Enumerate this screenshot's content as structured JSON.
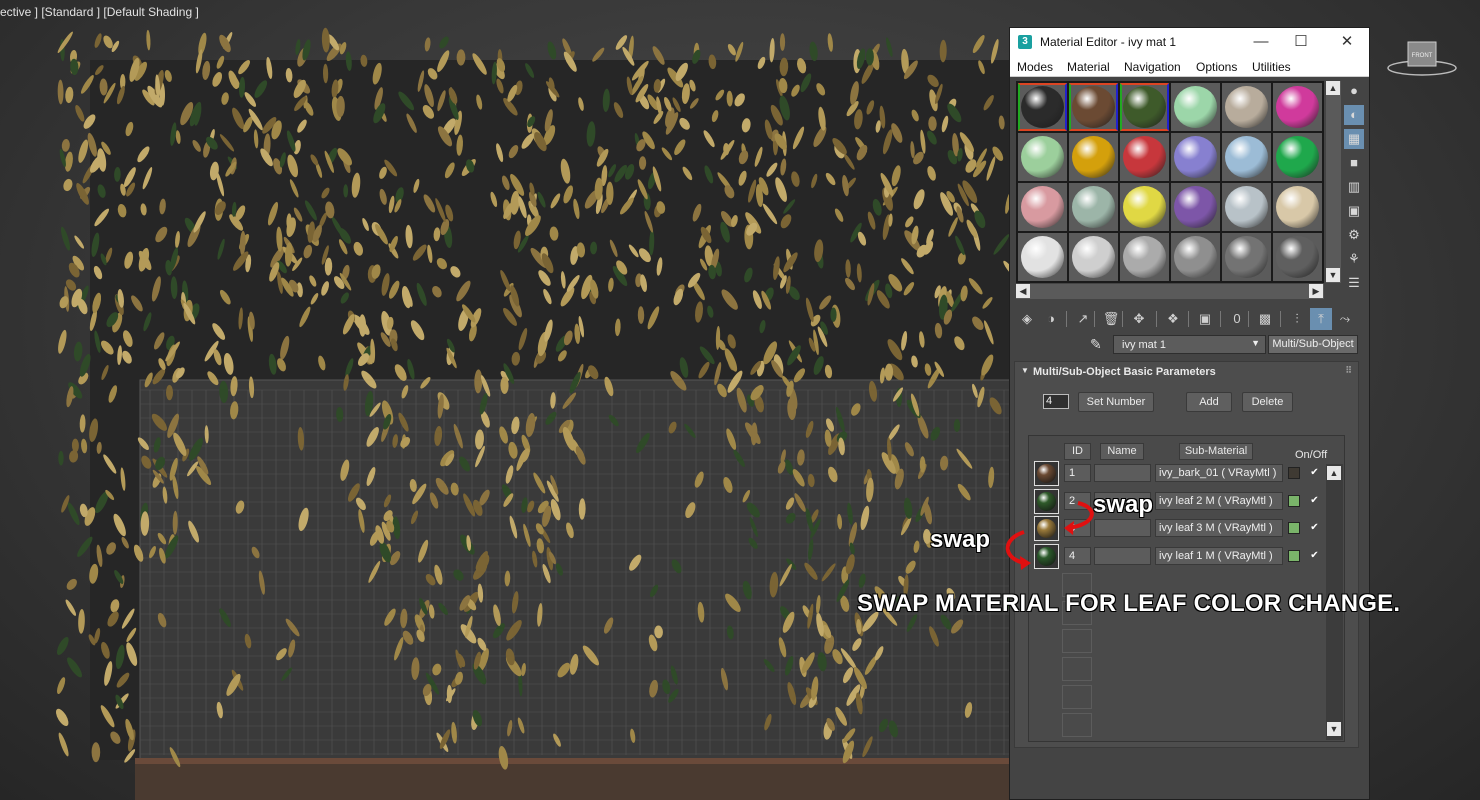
{
  "viewport": {
    "label": "ective ] [Standard ] [Default Shading ]",
    "viewcube_label": "FRONT"
  },
  "window": {
    "icon": "3",
    "title": "Material Editor -  ivy mat 1",
    "controls": {
      "minimize": "—",
      "maximize": "☐",
      "close": "✕"
    }
  },
  "menu": [
    "Modes",
    "Material",
    "Navigation",
    "Options",
    "Utilities"
  ],
  "slots": [
    {
      "color": "#2b2b2b",
      "used": true,
      "selected": true
    },
    {
      "color": "#6b4a33",
      "used": true,
      "selected": false
    },
    {
      "color": "#3e5a2a",
      "used": true,
      "selected": false
    },
    {
      "color": "#9cd6a9",
      "used": false,
      "selected": false
    },
    {
      "color": "#b8ac9c",
      "used": false,
      "selected": false
    },
    {
      "color": "#d03a9c",
      "used": false,
      "selected": false
    },
    {
      "color": "#9ccf9c",
      "used": false,
      "selected": false
    },
    {
      "color": "#d4a00c",
      "used": false,
      "selected": false
    },
    {
      "color": "#c7373c",
      "used": false,
      "selected": false
    },
    {
      "color": "#8780d0",
      "used": false,
      "selected": false
    },
    {
      "color": "#9cbcd6",
      "used": false,
      "selected": false
    },
    {
      "color": "#1fa84c",
      "used": false,
      "selected": false
    },
    {
      "color": "#d89aa0",
      "used": false,
      "selected": false
    },
    {
      "color": "#9cb5a8",
      "used": false,
      "selected": false
    },
    {
      "color": "#e0d844",
      "used": false,
      "selected": false
    },
    {
      "color": "#7d56a8",
      "used": false,
      "selected": false
    },
    {
      "color": "#b8c2c8",
      "used": false,
      "selected": false
    },
    {
      "color": "#d8c8a8",
      "used": false,
      "selected": false
    },
    {
      "color": "#e2e2e2",
      "used": false,
      "selected": false
    },
    {
      "color": "#cfcfcf",
      "used": false,
      "selected": false
    },
    {
      "color": "#ababab",
      "used": false,
      "selected": false
    },
    {
      "color": "#8f8f8f",
      "used": false,
      "selected": false
    },
    {
      "color": "#737373",
      "used": false,
      "selected": false
    },
    {
      "color": "#5f5f5f",
      "used": false,
      "selected": false
    }
  ],
  "side_tools": [
    "sample-type-icon",
    "backlight-icon",
    "background-icon",
    "sample-uv-tiling-icon",
    "video-color-check-icon",
    "make-preview-icon",
    "options-icon",
    "select-by-material-icon",
    "material-navigator-icon"
  ],
  "side_tool_glyphs": [
    "●",
    "◐",
    "▦",
    "■",
    "▥",
    "▣",
    "⚙",
    "⚘",
    "☰"
  ],
  "bottom_tools": [
    {
      "name": "get-material-icon",
      "glyph": "◈"
    },
    {
      "name": "put-to-scene-icon",
      "glyph": "◑"
    },
    {
      "name": "assign-to-selection-icon",
      "glyph": "↗"
    },
    {
      "name": "reset-map-icon",
      "glyph": "🗑"
    },
    {
      "name": "make-unique-icon",
      "glyph": "✥"
    },
    {
      "name": "copy-material-icon",
      "glyph": "❖"
    },
    {
      "name": "save-to-library-icon",
      "glyph": "▣"
    },
    {
      "name": "material-id-channel-icon",
      "glyph": "0"
    },
    {
      "name": "show-shaded-map-icon",
      "glyph": "▩"
    },
    {
      "name": "show-end-result-icon",
      "glyph": "⫶"
    },
    {
      "name": "go-to-parent-icon",
      "glyph": "⤒"
    },
    {
      "name": "go-forward-sibling-icon",
      "glyph": "⤳"
    }
  ],
  "material": {
    "name": "ivy mat 1",
    "type": "Multi/Sub-Object"
  },
  "rollout": {
    "title": "Multi/Sub-Object Basic Parameters",
    "count": "4",
    "set_number": "Set Number",
    "add": "Add",
    "delete": "Delete",
    "headers": {
      "id": "ID",
      "name": "Name",
      "sub_material": "Sub-Material",
      "onoff": "On/Off"
    },
    "rows": [
      {
        "id": "1",
        "sub": "ivy_bark_01  ( VRayMtl )",
        "swatch": "#3f3a33",
        "thumb": "#6b4a33",
        "on": "✔"
      },
      {
        "id": "2",
        "sub": "ivy  leaf 2 M  ( VRayMtl )",
        "swatch": "#7ab46a",
        "thumb": "#2f5a2a",
        "on": "✔"
      },
      {
        "id": "3",
        "sub": "ivy  leaf 3 M  ( VRayMtl )",
        "swatch": "#7ab46a",
        "thumb": "#9a7a3a",
        "on": "✔"
      },
      {
        "id": "4",
        "sub": "ivy  leaf 1 M  ( VRayMtl )",
        "swatch": "#7ab46a",
        "thumb": "#2a5a2a",
        "on": "✔"
      }
    ]
  },
  "annotations": {
    "swap_right": "swap",
    "swap_left": "swap",
    "caption": "SWAP MATERIAL FOR LEAF COLOR CHANGE."
  }
}
